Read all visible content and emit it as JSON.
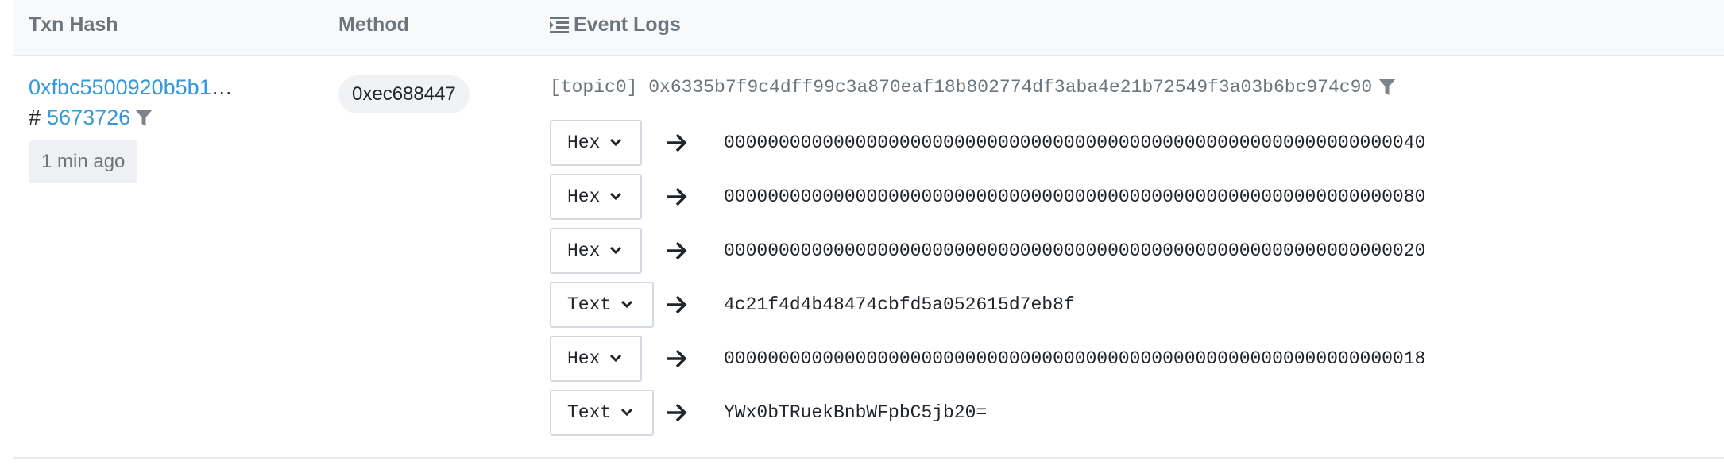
{
  "headers": {
    "txn_hash": "Txn Hash",
    "method": "Method",
    "event_logs": "Event Logs"
  },
  "row": {
    "txn_hash": "0xfbc5500920b5b1",
    "ellipsis": "…",
    "block_prefix": "#",
    "block": "5673726",
    "age": "1 min ago",
    "method": "0xec688447",
    "topic0": "[topic0] 0x6335b7f9c4dff99c3a870eaf18b802774df3aba4e21b72549f3a03b6bc974c90",
    "data": [
      {
        "format": "Hex",
        "value": "0000000000000000000000000000000000000000000000000000000000000040"
      },
      {
        "format": "Hex",
        "value": "0000000000000000000000000000000000000000000000000000000000000080"
      },
      {
        "format": "Hex",
        "value": "0000000000000000000000000000000000000000000000000000000000000020"
      },
      {
        "format": "Text",
        "value": "4c21f4d4b48474cbfd5a052615d7eb8f"
      },
      {
        "format": "Hex",
        "value": "0000000000000000000000000000000000000000000000000000000000000018"
      },
      {
        "format": "Text",
        "value": "YWx0bTRuekBnbWFpbC5jb20="
      }
    ]
  },
  "colors": {
    "link": "#3498db",
    "header_bg": "#f8f9fa",
    "muted": "#6c757d",
    "badge_bg": "#f1f2f4"
  },
  "icons": [
    "list-icon",
    "filter-icon",
    "chevron-down-icon",
    "arrow-right-icon"
  ]
}
